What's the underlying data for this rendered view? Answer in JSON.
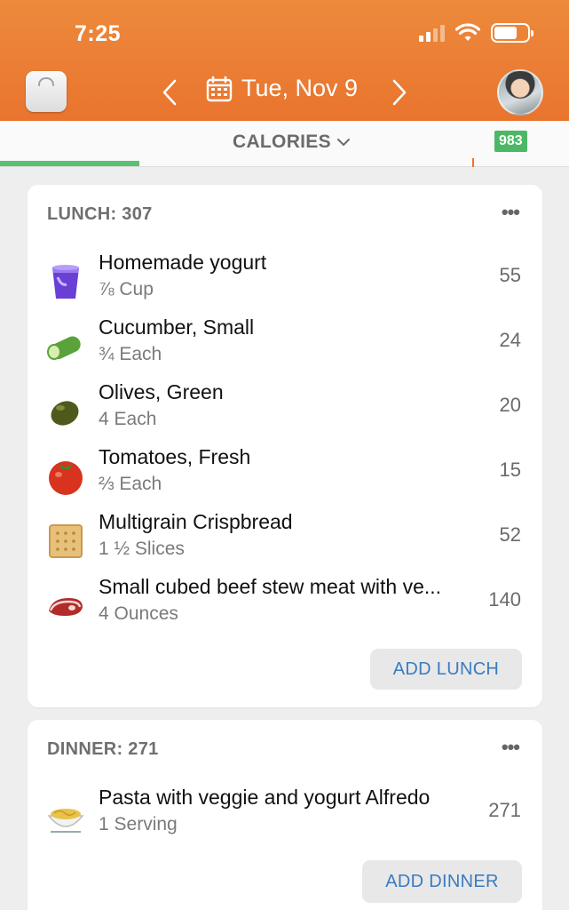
{
  "status": {
    "time": "7:25"
  },
  "header": {
    "date": "Tue, Nov 9"
  },
  "tab": {
    "label": "CALORIES",
    "remaining": "983"
  },
  "lunch": {
    "title": "LUNCH: 307",
    "more": "•••",
    "items": [
      {
        "name": "Homemade yogurt",
        "qty": "⅞ Cup",
        "cal": "55",
        "icon": "yogurt-icon"
      },
      {
        "name": "Cucumber, Small",
        "qty": "¾ Each",
        "cal": "24",
        "icon": "cucumber-icon"
      },
      {
        "name": "Olives, Green",
        "qty": "4 Each",
        "cal": "20",
        "icon": "olive-icon"
      },
      {
        "name": "Tomatoes, Fresh",
        "qty": "⅔ Each",
        "cal": "15",
        "icon": "tomato-icon"
      },
      {
        "name": "Multigrain Crispbread",
        "qty": "1 ½ Slices",
        "cal": "52",
        "icon": "crispbread-icon"
      },
      {
        "name": "Small cubed beef stew meat with ve...",
        "qty": "4 Ounces",
        "cal": "140",
        "icon": "steak-icon"
      }
    ],
    "add_label": "ADD LUNCH"
  },
  "dinner": {
    "title": "DINNER: 271",
    "more": "•••",
    "items": [
      {
        "name": "Pasta with veggie and yogurt Alfredo",
        "qty": "1 Serving",
        "cal": "271",
        "icon": "pasta-bowl-icon"
      }
    ],
    "add_label": "ADD DINNER"
  },
  "colors": {
    "header": "#e9742e",
    "progress": "#5cc072",
    "link": "#3a7bbf",
    "badge": "#4cb866"
  }
}
